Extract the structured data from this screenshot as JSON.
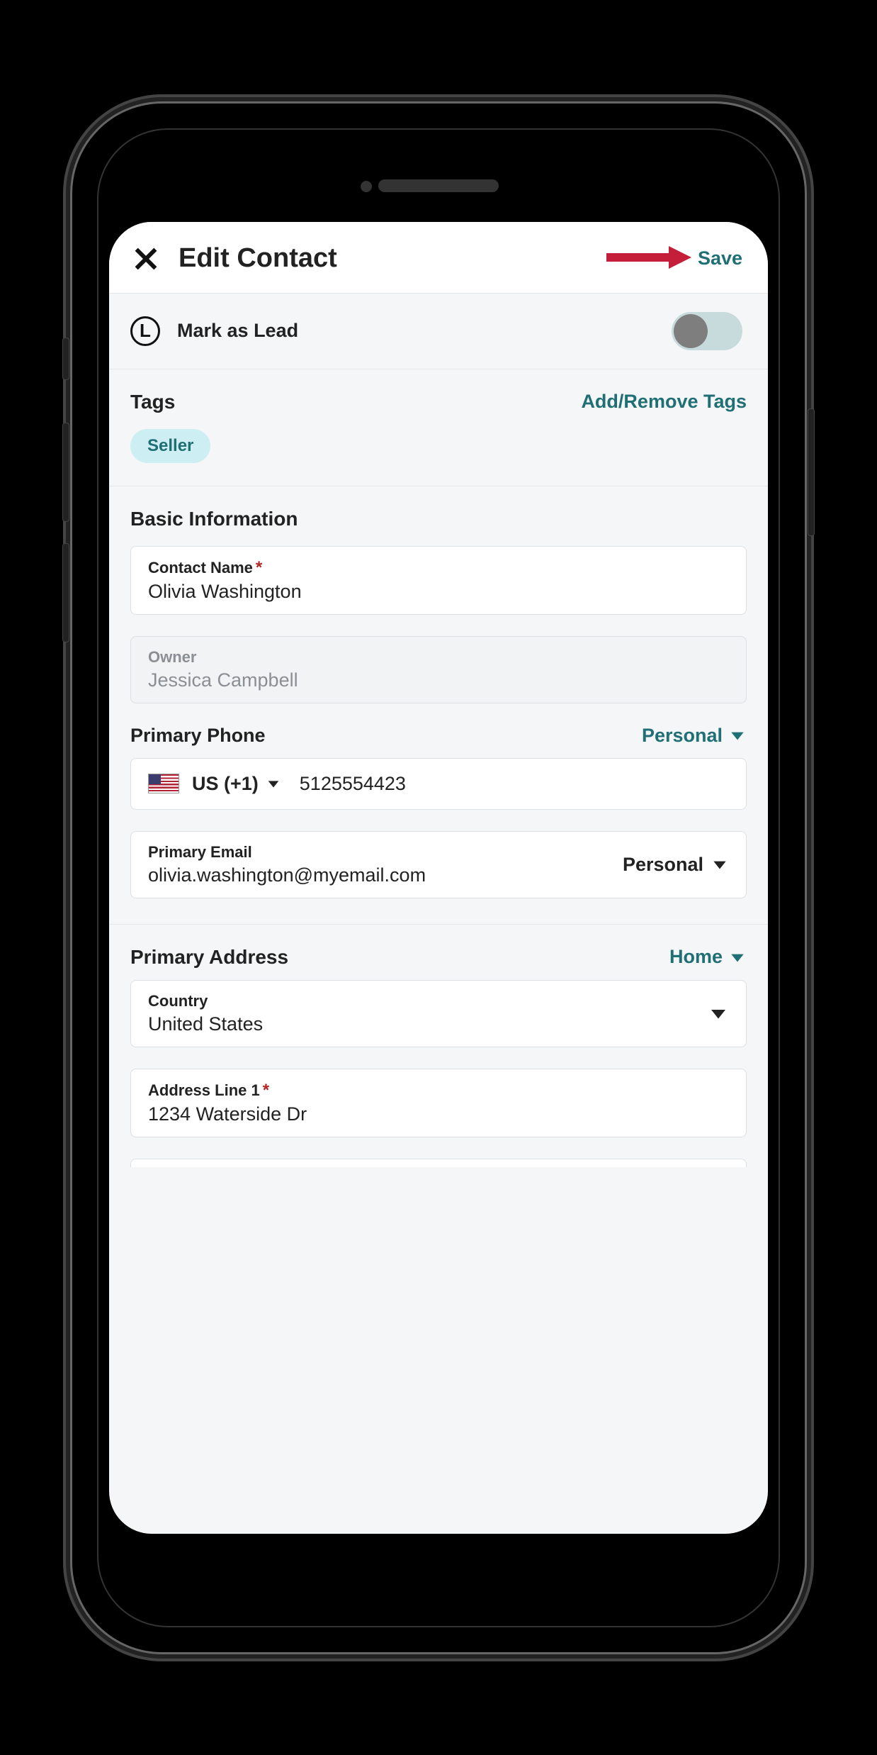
{
  "header": {
    "title": "Edit Contact",
    "save_label": "Save"
  },
  "lead": {
    "icon_letter": "L",
    "label": "Mark as Lead",
    "state": "off"
  },
  "tags": {
    "title": "Tags",
    "action_label": "Add/Remove Tags",
    "items": [
      "Seller"
    ]
  },
  "basic_info": {
    "title": "Basic Information",
    "contact_name": {
      "label": "Contact Name",
      "required": true,
      "value": "Olivia Washington"
    },
    "owner": {
      "label": "Owner",
      "value": "Jessica Campbell",
      "disabled": true
    },
    "primary_phone": {
      "label": "Primary Phone",
      "type_label": "Personal",
      "country_code_display": "US (+1)",
      "number": "5125554423"
    },
    "primary_email": {
      "label": "Primary Email",
      "value": "olivia.washington@myemail.com",
      "type_label": "Personal"
    }
  },
  "primary_address": {
    "title": "Primary Address",
    "type_label": "Home",
    "country": {
      "label": "Country",
      "value": "United States"
    },
    "address_line_1": {
      "label": "Address Line 1",
      "required": true,
      "value": "1234 Waterside Dr"
    }
  },
  "colors": {
    "accent": "#1f6f75"
  }
}
